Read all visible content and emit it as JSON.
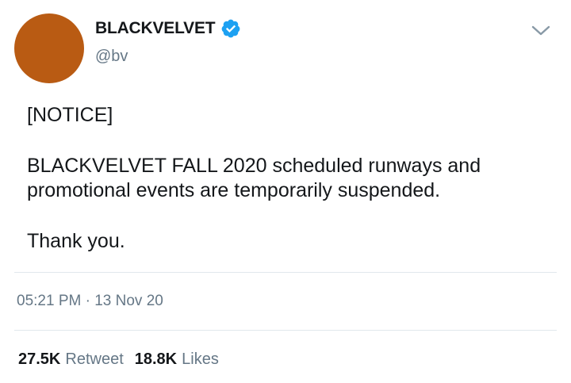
{
  "colors": {
    "avatar": "#b95b13",
    "verified_badge": "#1da1f2",
    "secondary_text": "#657786",
    "divider": "#e1e8ed"
  },
  "author": {
    "display_name": "BLACKVELVET",
    "handle": "@bv",
    "verified": true,
    "verified_icon": "verified-badge-icon"
  },
  "menu_icon": "chevron-down-icon",
  "tweet": {
    "lines": {
      "notice": "[NOTICE]",
      "message_line_1": "BLACKVELVET FALL 2020 scheduled runways and",
      "message_line_2": "promotional events are temporarily suspended.",
      "thanks": "Thank you."
    },
    "time": "05:21 PM",
    "separator": "·",
    "date": "13 Nov 20"
  },
  "stats": {
    "retweets": {
      "count": "27.5K",
      "label": "Retweet"
    },
    "likes": {
      "count": "18.8K",
      "label": "Likes"
    }
  }
}
